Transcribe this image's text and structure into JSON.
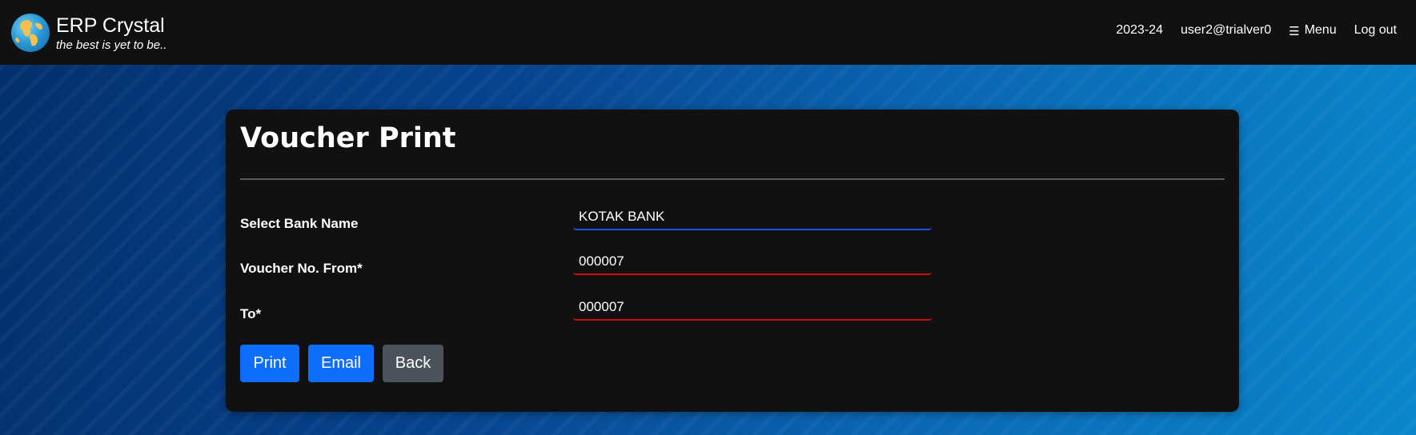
{
  "app": {
    "name": "ERP Crystal",
    "tagline": "the best is yet to be.."
  },
  "nav": {
    "year": "2023-24",
    "user": "user2@trialver0",
    "menu_label": "Menu",
    "menu_icon": "hamburger-icon",
    "logout_label": "Log out"
  },
  "page": {
    "title": "Voucher Print"
  },
  "form": {
    "bank": {
      "label": "Select Bank Name",
      "value": "KOTAK BANK"
    },
    "voucher_from": {
      "label": "Voucher No. From*",
      "value": "000007"
    },
    "voucher_to": {
      "label": "To*",
      "value": "000007"
    }
  },
  "buttons": {
    "print": "Print",
    "email": "Email",
    "back": "Back"
  },
  "colors": {
    "accent": "#0d6efd",
    "secondary": "#4b5259",
    "required_underline": "#d10a0a",
    "select_underline": "#2350d8"
  }
}
